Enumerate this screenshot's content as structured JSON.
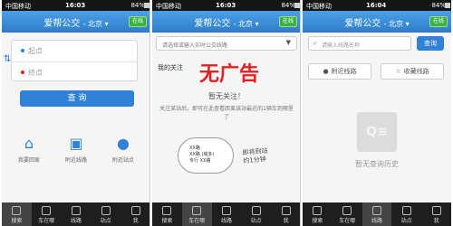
{
  "status": {
    "carrier": "中国移动",
    "bt": "84%",
    "times": [
      "16:03",
      "16:03",
      "16:04"
    ]
  },
  "app": {
    "title": "爱帮公交",
    "city": "- 北京 ▾",
    "online": "在线"
  },
  "tabs": [
    "搜索",
    "车在哪",
    "线路",
    "站点",
    "我"
  ],
  "screen1": {
    "start_placeholder": "起点",
    "end_placeholder": "终点",
    "query_button": "查 询",
    "quick": [
      {
        "label": "我要回家",
        "icon": "home-icon"
      },
      {
        "label": "附近线路",
        "icon": "bus-icon"
      },
      {
        "label": "附近站点",
        "icon": "location-pin-icon"
      }
    ]
  },
  "screen2": {
    "select_placeholder": "请选择或输入实时公交线路",
    "section_title": "我的关注",
    "noad_text": "无广告",
    "empty_title": "暂无关注！",
    "hint": "关注某站后，即可在此查看距离该站最近的1辆车到哪里了",
    "bubble_lines": [
      "XX路",
      "XX路 (域多)",
      "专行 XX路"
    ],
    "handnote_lines": [
      "即将到站",
      "约1分钟"
    ]
  },
  "screen3": {
    "search_placeholder": "请输入线路名称",
    "search_button": "查询",
    "nearby_lines": "附近线路",
    "fav_lines": "收藏线路",
    "empty_text": "暂无查询历史"
  },
  "colors": {
    "accent": "#2f82d6",
    "online": "#3bb341",
    "noad": "#e52020"
  }
}
